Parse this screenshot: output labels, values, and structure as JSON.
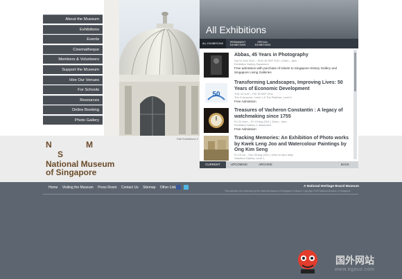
{
  "nav": {
    "items": [
      "About the Museum",
      "Exhibitions",
      "Events",
      "Cinematheque",
      "Members & Volunteers",
      "Support the Museum",
      "Hire Our Venues",
      "For Schools",
      "Resources",
      "Online Booking",
      "Photo Gallery"
    ]
  },
  "photo": {
    "credit": "©All Exhibitions 2"
  },
  "logo": {
    "letters": [
      "N",
      "M",
      "S"
    ],
    "name": "National Museum",
    "name2": "of Singapore"
  },
  "panel": {
    "title": "All Exhibitions",
    "tabs": [
      [
        "ALL EXHIBITIONS"
      ],
      [
        "PERMANENT",
        "EXHIBITIONS"
      ],
      [
        "SPECIAL",
        "EXHIBITIONS"
      ]
    ],
    "exhibitions": [
      {
        "title": "Abbas, 45 Years in Photography",
        "meta": [
          "Sat 10 JUN 2011 – SUN 18 SEP 2011 | 10am – 6pm",
          "Exhibition Gallery, Basement"
        ],
        "desc": "Free admission with purchase of tickets to Singapore History Gallery and Singapore Living Galleries"
      },
      {
        "title": "Transforming Landscapes, Improving Lives: 50 Years of Economic Development",
        "meta": [
          "TUE 15 JUN – FRI 30 SEP 2011",
          "The Concourse, Level 1 & The Platform, Level 2"
        ],
        "desc": "Free Admission"
      },
      {
        "title": "Treasures of Vacheron Constantin : A legacy of watchmaking since 1755",
        "meta": [
          "Fri 24 June – Fri 19 Aug 2011 | 10am – 6pm",
          "Exhibition Gallery 1, Basement"
        ],
        "desc": "Free Admission"
      },
      {
        "title": "Tracking Memories: An Exhibition of Photo works by Kwek Leng Joo and Watercolour Paintings by Ong Kim Seng",
        "meta": [
          "Fri 15 Jul – Sun 28 Aug 2011 | 10am to 6pm daily",
          "Stamford Gallery, Level 1"
        ],
        "desc": ""
      }
    ],
    "bottom_tabs": [
      "CURRENT",
      "UPCOMING",
      "ARCHIVE",
      "BACK"
    ]
  },
  "footer": {
    "links": [
      "Home",
      "Visiting the Museum",
      "Press Room",
      "Contact Us",
      "Sitemap",
      "Other Links"
    ],
    "nhb": "A National Heritage Board Museum",
    "copyright": "This website is an extension by the National Museum of Singapore & Mpam | Copyright 2009 National Museum of Singapore"
  },
  "watermark": {
    "cn": "国外网站",
    "url": "www.egouz.com"
  }
}
